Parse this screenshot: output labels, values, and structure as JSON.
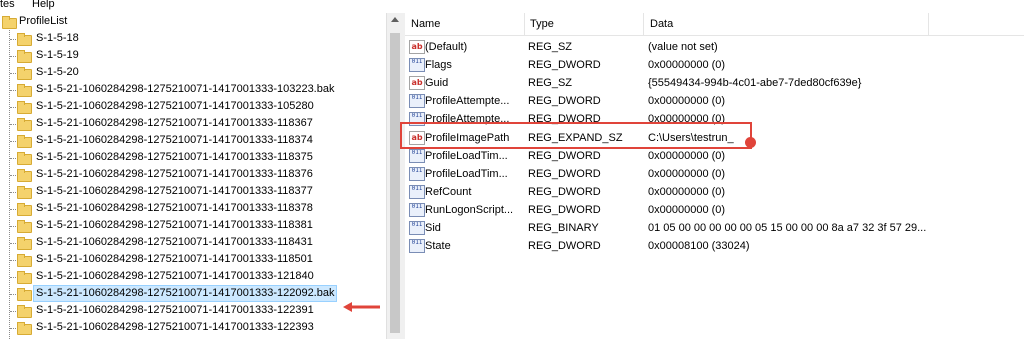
{
  "menubar": {
    "item_1": "tes",
    "item_2": "Help"
  },
  "tree": {
    "root": "ProfileList",
    "items": [
      "S-1-5-18",
      "S-1-5-19",
      "S-1-5-20",
      "S-1-5-21-1060284298-1275210071-1417001333-103223.bak",
      "S-1-5-21-1060284298-1275210071-1417001333-105280",
      "S-1-5-21-1060284298-1275210071-1417001333-118367",
      "S-1-5-21-1060284298-1275210071-1417001333-118374",
      "S-1-5-21-1060284298-1275210071-1417001333-118375",
      "S-1-5-21-1060284298-1275210071-1417001333-118376",
      "S-1-5-21-1060284298-1275210071-1417001333-118377",
      "S-1-5-21-1060284298-1275210071-1417001333-118378",
      "S-1-5-21-1060284298-1275210071-1417001333-118381",
      "S-1-5-21-1060284298-1275210071-1417001333-118431",
      "S-1-5-21-1060284298-1275210071-1417001333-118501",
      "S-1-5-21-1060284298-1275210071-1417001333-121840",
      "S-1-5-21-1060284298-1275210071-1417001333-122092.bak",
      "S-1-5-21-1060284298-1275210071-1417001333-122391",
      "S-1-5-21-1060284298-1275210071-1417001333-122393"
    ],
    "selected_index": 15
  },
  "list": {
    "columns": {
      "name": "Name",
      "type": "Type",
      "data": "Data"
    },
    "rows": [
      {
        "name": "(Default)",
        "type": "REG_SZ",
        "data": "(value not set)",
        "icon": "string-value-icon",
        "icon_text": "ab"
      },
      {
        "name": "Flags",
        "type": "REG_DWORD",
        "data": "0x00000000 (0)",
        "icon": "binary-value-icon",
        "icon_text": "011"
      },
      {
        "name": "Guid",
        "type": "REG_SZ",
        "data": "{55549434-994b-4c01-abe7-7ded80cf639e}",
        "icon": "string-value-icon",
        "icon_text": "ab"
      },
      {
        "name": "ProfileAttempte...",
        "type": "REG_DWORD",
        "data": "0x00000000 (0)",
        "icon": "binary-value-icon",
        "icon_text": "011"
      },
      {
        "name": "ProfileAttempte...",
        "type": "REG_DWORD",
        "data": "0x00000000 (0)",
        "icon": "binary-value-icon",
        "icon_text": "011"
      },
      {
        "name": "ProfileImagePath",
        "type": "REG_EXPAND_SZ",
        "data": "C:\\Users\\testrun_",
        "icon": "string-value-icon",
        "icon_text": "ab"
      },
      {
        "name": "ProfileLoadTim...",
        "type": "REG_DWORD",
        "data": "0x00000000 (0)",
        "icon": "binary-value-icon",
        "icon_text": "011"
      },
      {
        "name": "ProfileLoadTim...",
        "type": "REG_DWORD",
        "data": "0x00000000 (0)",
        "icon": "binary-value-icon",
        "icon_text": "011"
      },
      {
        "name": "RefCount",
        "type": "REG_DWORD",
        "data": "0x00000000 (0)",
        "icon": "binary-value-icon",
        "icon_text": "011"
      },
      {
        "name": "RunLogonScript...",
        "type": "REG_DWORD",
        "data": "0x00000000 (0)",
        "icon": "binary-value-icon",
        "icon_text": "011"
      },
      {
        "name": "Sid",
        "type": "REG_BINARY",
        "data": "01 05 00 00 00 00 00 05 15 00 00 00 8a a7 32 3f 57 29...",
        "icon": "binary-value-icon",
        "icon_text": "011"
      },
      {
        "name": "State",
        "type": "REG_DWORD",
        "data": "0x00008100 (33024)",
        "icon": "binary-value-icon",
        "icon_text": "011"
      }
    ]
  },
  "annotation_color": "#e0443a"
}
